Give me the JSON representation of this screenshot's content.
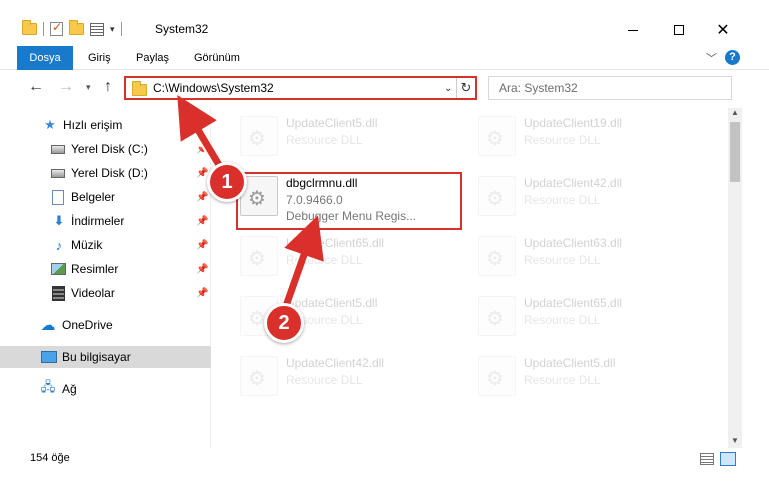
{
  "window": {
    "title": "System32"
  },
  "ribbon": {
    "tabs": [
      "Dosya",
      "Giriş",
      "Paylaş",
      "Görünüm"
    ]
  },
  "address_bar": {
    "path": "C:\\Windows\\System32"
  },
  "search": {
    "placeholder": "Ara: System32"
  },
  "sidebar": {
    "quick_access": "Hızlı erişim",
    "items": [
      {
        "label": "Yerel Disk (C:)",
        "icon": "disk-icon",
        "pinned": true
      },
      {
        "label": "Yerel Disk (D:)",
        "icon": "disk-icon",
        "pinned": true
      },
      {
        "label": "Belgeler",
        "icon": "documents-icon",
        "pinned": true
      },
      {
        "label": "İndirmeler",
        "icon": "downloads-icon",
        "pinned": true
      },
      {
        "label": "Müzik",
        "icon": "music-icon",
        "pinned": true
      },
      {
        "label": "Resimler",
        "icon": "pictures-icon",
        "pinned": true
      },
      {
        "label": "Videolar",
        "icon": "videos-icon",
        "pinned": true
      }
    ],
    "onedrive": "OneDrive",
    "this_pc": "Bu bilgisayar",
    "network": "Ağ"
  },
  "files": {
    "highlighted": {
      "name": "dbgclrmnu.dll",
      "version": "7.0.9466.0",
      "description": "Debugger Menu Regis..."
    },
    "background": [
      {
        "name": "UpdateClient5.dll",
        "desc": "Resource DLL"
      },
      {
        "name": "UpdateClient19.dll",
        "desc": "Resource DLL"
      },
      {
        "name": "UpdateClient42.dll",
        "desc": "Resource DLL"
      },
      {
        "name": "UpdateClient65.dll",
        "desc": "Resource DLL"
      },
      {
        "name": "UpdateClient63.dll",
        "desc": "Resource DLL"
      },
      {
        "name": "UpdateClient5.dll",
        "desc": "Resource DLL"
      },
      {
        "name": "UpdateClient65.dll",
        "desc": "Resource DLL"
      },
      {
        "name": "UpdateClient42.dll",
        "desc": "Resource DLL"
      },
      {
        "name": "UpdateClient5.dll",
        "desc": "Resource DLL"
      }
    ]
  },
  "status": {
    "count": "154 öğe"
  },
  "annotations": {
    "step1": "1",
    "step2": "2",
    "color": "#d9302b"
  }
}
